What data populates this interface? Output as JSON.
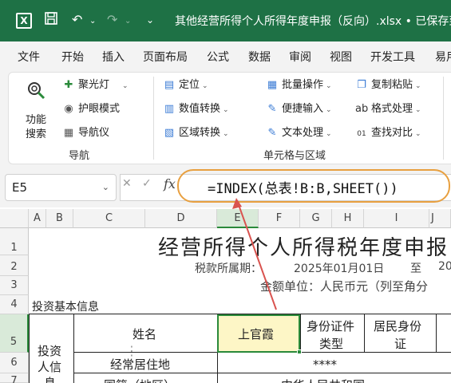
{
  "titlebar": {
    "doc_title": "其他经营所得个人所得年度申报（反向）.xlsx • 已保存到"
  },
  "menu": [
    "文件",
    "开始",
    "插入",
    "页面布局",
    "公式",
    "数据",
    "审阅",
    "视图",
    "开发工具",
    "易用"
  ],
  "ribbon": {
    "feature_search": [
      "功能",
      "搜索"
    ],
    "spotlight": "聚光灯",
    "eye_care": "护眼模式",
    "navigator": "导航仪",
    "nav_group": "导航",
    "locate": "定位",
    "num_convert": "数值转换",
    "range_convert": "区域转换",
    "batch_ops": "批量操作",
    "easy_input": "便捷输入",
    "text_process": "文本处理",
    "copy_paste": "复制粘贴",
    "format_process": "格式处理",
    "find_compare": "查找对比",
    "cell_group": "单元格与区域"
  },
  "formula_bar": {
    "name_box": "E5",
    "fx": "fx",
    "formula": "=INDEX(总表!B:B,SHEET())"
  },
  "columns": [
    "A",
    "B",
    "C",
    "D",
    "E",
    "F",
    "G",
    "H",
    "I",
    "J"
  ],
  "rows": [
    "1",
    "2",
    "3",
    "4",
    "5",
    "6",
    "7"
  ],
  "sheet": {
    "title": "经营所得个人所得税年度申报",
    "period_label": "税款所属期：",
    "period_start": "2025年01月01日",
    "period_to": "至",
    "period_end": "20",
    "amount_unit": "金额单位：人民币元（列至角分",
    "investor_info": "投资基本信息",
    "investor_person": [
      "投资",
      "人信",
      "息"
    ],
    "name_label": "姓名",
    "name_value": "上官霞",
    "id_type": [
      "身份证件",
      "类型"
    ],
    "resident_id": [
      "居民身份",
      "证"
    ],
    "frequent_address": "经常居住地",
    "address_value": "****",
    "nationality": "国籍（地区）",
    "nationality_value": "中华人民共和国"
  }
}
